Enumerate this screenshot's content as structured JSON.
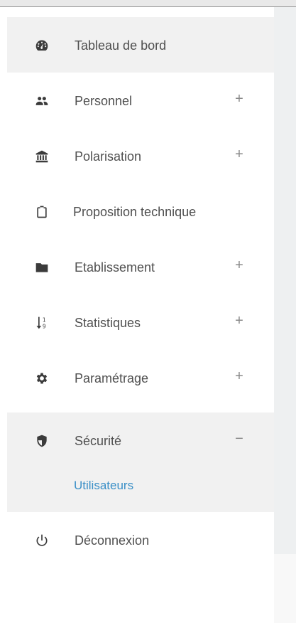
{
  "sidebar": {
    "items": [
      {
        "label": "Tableau de bord",
        "icon": "dashboard-icon",
        "toggle": ""
      },
      {
        "label": "Personnel",
        "icon": "users-icon",
        "toggle": "+"
      },
      {
        "label": "Polarisation",
        "icon": "bank-icon",
        "toggle": "+"
      },
      {
        "label": "Proposition technique",
        "icon": "clipboard-icon",
        "toggle": ""
      },
      {
        "label": "Etablissement",
        "icon": "folder-icon",
        "toggle": "+"
      },
      {
        "label": "Statistiques",
        "icon": "sort-numeric-icon",
        "toggle": "+"
      },
      {
        "label": "Paramétrage",
        "icon": "gear-icon",
        "toggle": "+"
      },
      {
        "label": "Sécurité",
        "icon": "shield-icon",
        "toggle": "−"
      },
      {
        "label": "Déconnexion",
        "icon": "power-icon",
        "toggle": ""
      }
    ],
    "security_submenu": [
      {
        "label": "Utilisateurs"
      }
    ]
  },
  "colors": {
    "active_bg": "#f1f1f1",
    "link": "#3a8fc7",
    "text": "#4f4f4f"
  }
}
